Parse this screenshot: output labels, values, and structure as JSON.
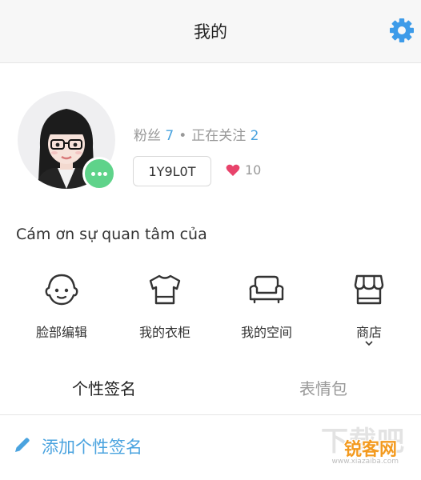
{
  "header": {
    "title": "我的",
    "settings_icon": "gear-icon",
    "accent_color": "#3d9be9"
  },
  "profile": {
    "followers_label": "粉丝",
    "followers_count": "7",
    "separator": "•",
    "following_label": "正在关注",
    "following_count": "2",
    "user_id": "1Y9L0T",
    "likes_count": "10",
    "bio": "Cám ơn sự quan tâm của",
    "badge_icon": "more-dots-icon",
    "like_icon": "heart-icon"
  },
  "features": [
    {
      "label": "脸部编辑",
      "icon": "face-icon"
    },
    {
      "label": "我的衣柜",
      "icon": "tshirt-icon"
    },
    {
      "label": "我的空间",
      "icon": "sofa-icon"
    },
    {
      "label": "商店",
      "icon": "store-icon"
    }
  ],
  "tabs": [
    {
      "label": "个性签名",
      "active": true
    },
    {
      "label": "表情包",
      "active": false
    }
  ],
  "signature": {
    "add_label": "添加个性签名",
    "icon": "pencil-icon"
  },
  "watermark": {
    "big": "下载吧",
    "main": "锐客网",
    "small": "www.xiazaiba.com"
  },
  "colors": {
    "link_blue": "#4aa3df",
    "badge_green": "#5fd38a",
    "heart_pink": "#e8436b",
    "muted_gray": "#999999"
  }
}
